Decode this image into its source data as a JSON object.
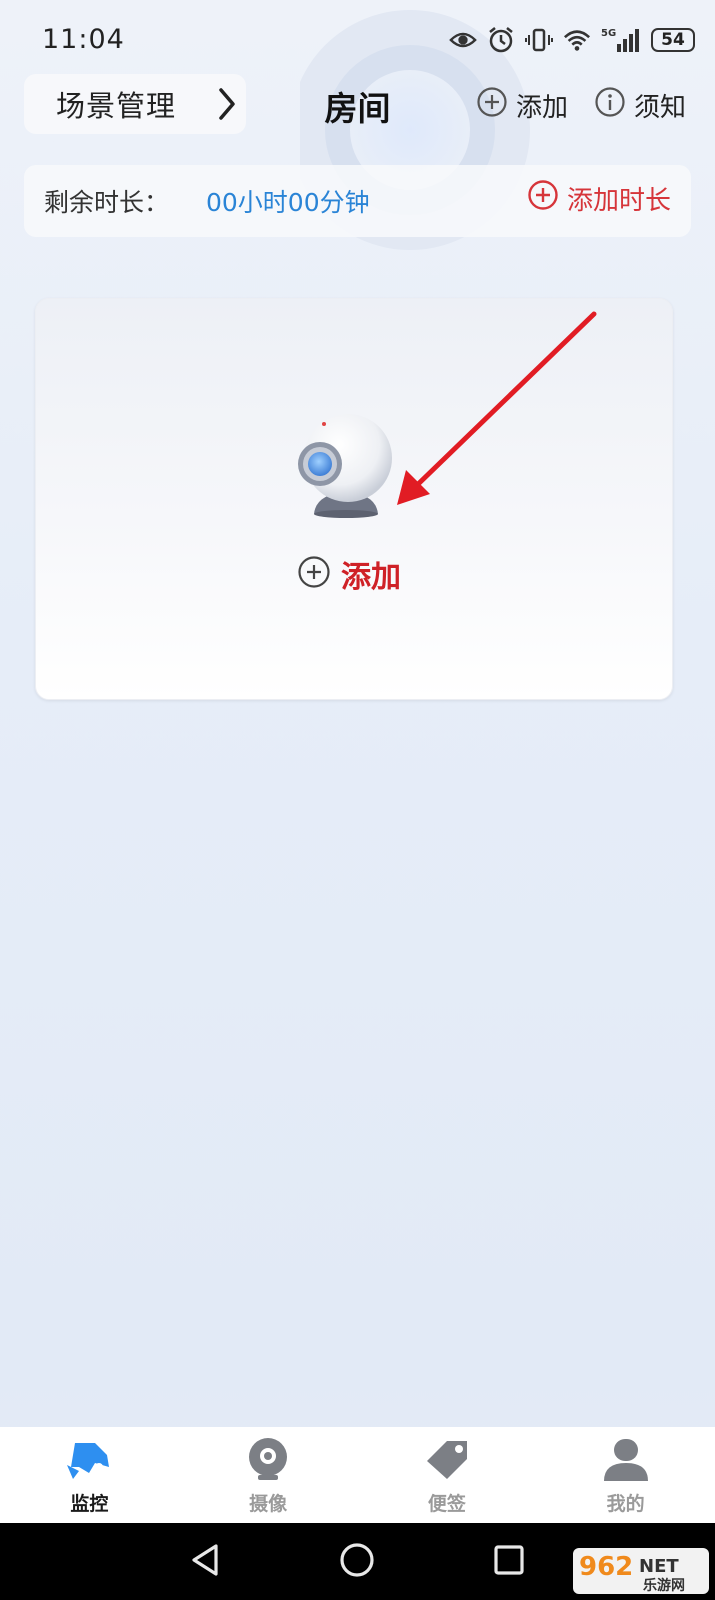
{
  "status_bar": {
    "time": "11:04",
    "battery": "54",
    "network": "5G"
  },
  "header": {
    "scene_label": "场景管理",
    "title": "房间",
    "add_label": "添加",
    "notice_label": "须知"
  },
  "remaining": {
    "label": "剩余时长：",
    "value": "00小时00分钟",
    "add_time_label": "添加时长"
  },
  "card": {
    "add_label": "添加"
  },
  "bottom_nav": {
    "items": [
      {
        "label": "监控",
        "icon": "monitor-icon",
        "active": true
      },
      {
        "label": "摄像",
        "icon": "camera-icon",
        "active": false
      },
      {
        "label": "便签",
        "icon": "tag-icon",
        "active": false
      },
      {
        "label": "我的",
        "icon": "profile-icon",
        "active": false
      }
    ]
  },
  "watermark": {
    "brand": "962",
    "suffix": "NET",
    "sub": "乐游网"
  },
  "colors": {
    "accent_red": "#cf2127",
    "accent_blue": "#2a84d6",
    "nav_active": "#2e8ff0"
  }
}
